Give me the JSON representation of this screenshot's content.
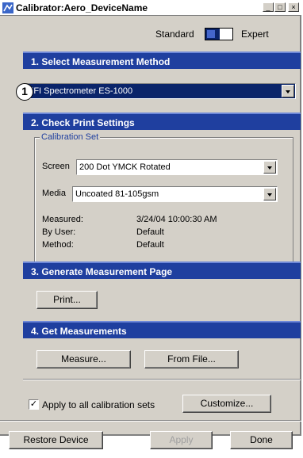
{
  "window": {
    "title": "Calibrator:Aero_DeviceName",
    "minimize_glyph": "_",
    "maximize_glyph": "□",
    "close_glyph": "×"
  },
  "mode": {
    "left_label": "Standard",
    "right_label": "Expert",
    "selected": "Standard"
  },
  "section1": {
    "title": "1. Select Measurement Method",
    "method_value": "EFI Spectrometer ES-1000",
    "callout_number": "1"
  },
  "section2": {
    "title": "2. Check Print Settings",
    "group_title": "Calibration Set",
    "screen_label": "Screen",
    "screen_value": "200 Dot YMCK Rotated",
    "media_label": "Media",
    "media_value": "Uncoated 81-105gsm",
    "info": [
      {
        "label": "Measured:",
        "value": "3/24/04 10:00:30 AM"
      },
      {
        "label": "By User:",
        "value": "Default"
      },
      {
        "label": "Method:",
        "value": "Default"
      }
    ]
  },
  "section3": {
    "title": "3. Generate Measurement Page",
    "print_label": "Print..."
  },
  "section4": {
    "title": "4. Get Measurements",
    "measure_label": "Measure...",
    "from_file_label": "From File..."
  },
  "options": {
    "apply_all_label": "Apply to all calibration sets",
    "apply_all_checked": true,
    "customize_label": "Customize..."
  },
  "footer": {
    "restore_label": "Restore Device",
    "apply_label": "Apply",
    "done_label": "Done"
  },
  "colors": {
    "header_blue": "#1f3f9f",
    "selection_blue": "#0a246a",
    "face": "#d4d0c8"
  }
}
